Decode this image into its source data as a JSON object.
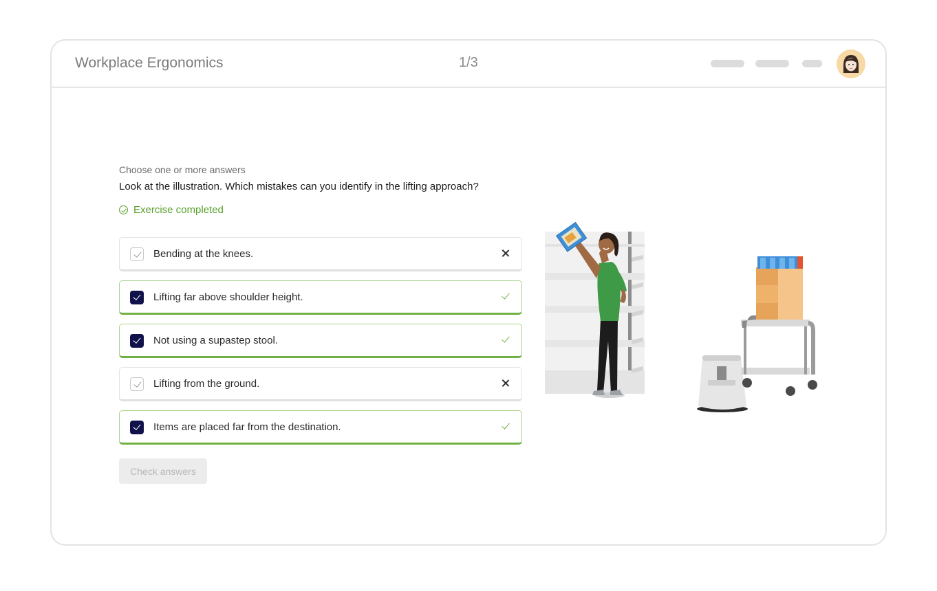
{
  "header": {
    "title": "Workplace Ergonomics",
    "page_count": "1/3",
    "nav_icon": "avatar-icon"
  },
  "exercise": {
    "hint": "Choose one or more answers",
    "question": "Look at the illustration. Which mistakes can you identify in the lifting approach?",
    "status": "Exercise completed",
    "status_color": "#5aa02c",
    "answers": [
      {
        "label": "Bending at the knees.",
        "checked": false,
        "result": "incorrect"
      },
      {
        "label": "Lifting far above shoulder height.",
        "checked": true,
        "result": "correct"
      },
      {
        "label": "Not using a supastep stool.",
        "checked": true,
        "result": "correct"
      },
      {
        "label": "Lifting from the ground.",
        "checked": false,
        "result": "incorrect"
      },
      {
        "label": "Items are placed far from the destination.",
        "checked": true,
        "result": "correct"
      }
    ],
    "check_button": "Check answers"
  },
  "colors": {
    "checkbox_checked": "#12124b",
    "correct_border": "#6fb142"
  }
}
